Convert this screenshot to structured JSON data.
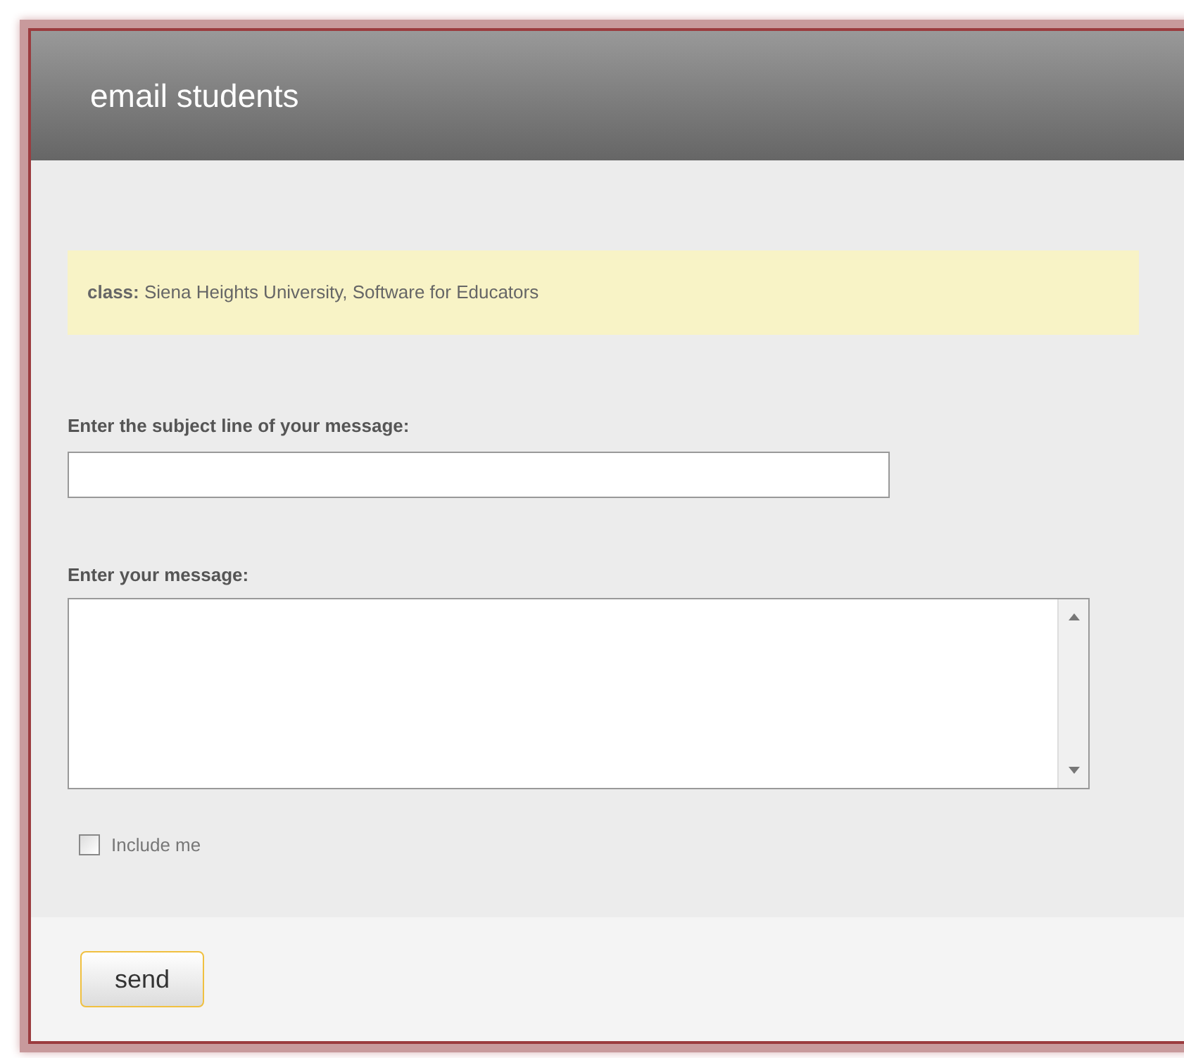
{
  "header": {
    "title": "email students"
  },
  "class_info": {
    "label": "class:",
    "value": "Siena Heights University, Software for Educators"
  },
  "subject": {
    "label": "Enter the subject line of your message:"
  },
  "message": {
    "label": "Enter your message:"
  },
  "include_me": {
    "label": "Include me",
    "checked": false
  },
  "send_button": "send"
}
